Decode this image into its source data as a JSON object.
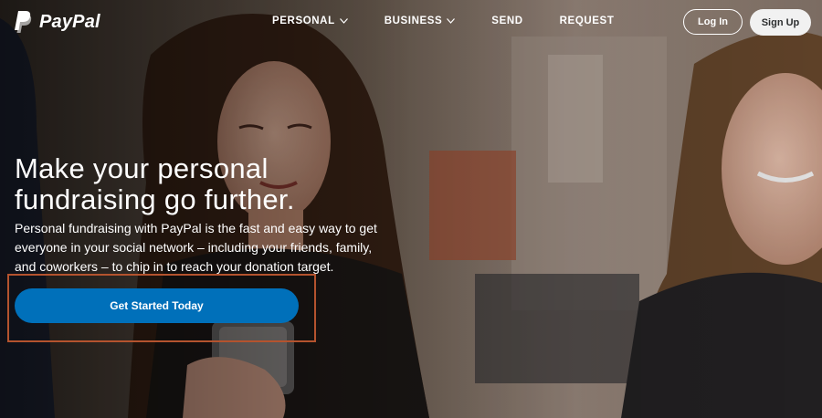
{
  "nav": {
    "brand": "PayPal",
    "items": [
      {
        "label": "PERSONAL",
        "has_dropdown": true
      },
      {
        "label": "BUSINESS",
        "has_dropdown": true
      },
      {
        "label": "SEND",
        "has_dropdown": false
      },
      {
        "label": "REQUEST",
        "has_dropdown": false
      }
    ],
    "login_label": "Log In",
    "signup_label": "Sign Up"
  },
  "hero": {
    "headline_line1": "Make your personal",
    "headline_line2": "fundraising go further.",
    "subtext": "Personal fundraising with PayPal is the fast and easy way to get everyone in your social network – including your friends, family, and coworkers – to chip in to reach your donation target.",
    "cta_label": "Get Started Today"
  },
  "colors": {
    "cta_blue": "#0070ba",
    "highlight_border": "#b4532e",
    "text_white": "#ffffff",
    "signup_bg": "#f1f1f1"
  },
  "icons": [
    "paypal-logo-icon",
    "chevron-down-icon"
  ]
}
